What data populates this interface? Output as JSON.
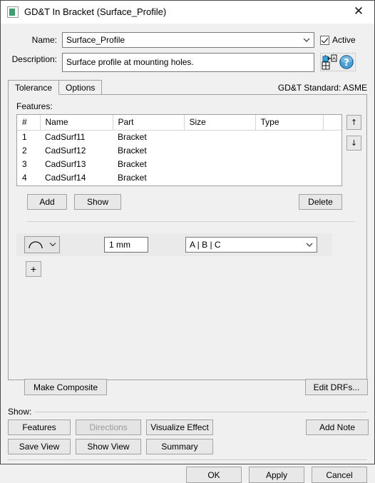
{
  "window": {
    "title": "GD&T In Bracket (Surface_Profile)",
    "icon": "gdt-window-icon",
    "close_label": "✕"
  },
  "form": {
    "name_label": "Name:",
    "name_value": "Surface_Profile",
    "description_label": "Description:",
    "description_value": "Surface profile at mounting holes.",
    "active_label": "Active",
    "active_checked": true,
    "symbol_picker_icon": "gdt-symbol-picker-icon",
    "help_icon": "help-question-icon"
  },
  "tabs": [
    {
      "label": "Tolerance",
      "active": true
    },
    {
      "label": "Options",
      "active": false
    }
  ],
  "standard_label": "GD&T Standard: ASME",
  "features": {
    "section_label": "Features:",
    "columns": [
      "#",
      "Name",
      "Part",
      "Size",
      "Type",
      ""
    ],
    "rows": [
      {
        "num": "1",
        "name": "CadSurf11",
        "part": "Bracket",
        "size": "",
        "type": ""
      },
      {
        "num": "2",
        "name": "CadSurf12",
        "part": "Bracket",
        "size": "",
        "type": ""
      },
      {
        "num": "3",
        "name": "CadSurf13",
        "part": "Bracket",
        "size": "",
        "type": ""
      },
      {
        "num": "4",
        "name": "CadSurf14",
        "part": "Bracket",
        "size": "",
        "type": ""
      }
    ],
    "move_up_label": "↑",
    "move_down_label": "↓",
    "add_label": "Add",
    "show_label": "Show",
    "delete_label": "Delete"
  },
  "tolerance_row": {
    "symbol": "surface-profile-symbol",
    "value": "1 mm",
    "datum_reference": "A | B | C",
    "add_row_label": "+"
  },
  "composite": {
    "make_composite_label": "Make Composite",
    "edit_drfs_label": "Edit DRFs..."
  },
  "show_group": {
    "title": "Show:",
    "buttons": [
      {
        "label": "Features",
        "disabled": false
      },
      {
        "label": "Directions",
        "disabled": true
      },
      {
        "label": "Visualize Effect",
        "disabled": false
      },
      {
        "label": "Add Note",
        "disabled": false
      },
      {
        "label": "Save View",
        "disabled": false
      },
      {
        "label": "Show View",
        "disabled": false
      },
      {
        "label": "Summary",
        "disabled": false
      }
    ]
  },
  "footer": {
    "ok_label": "OK",
    "apply_label": "Apply",
    "cancel_label": "Cancel"
  }
}
